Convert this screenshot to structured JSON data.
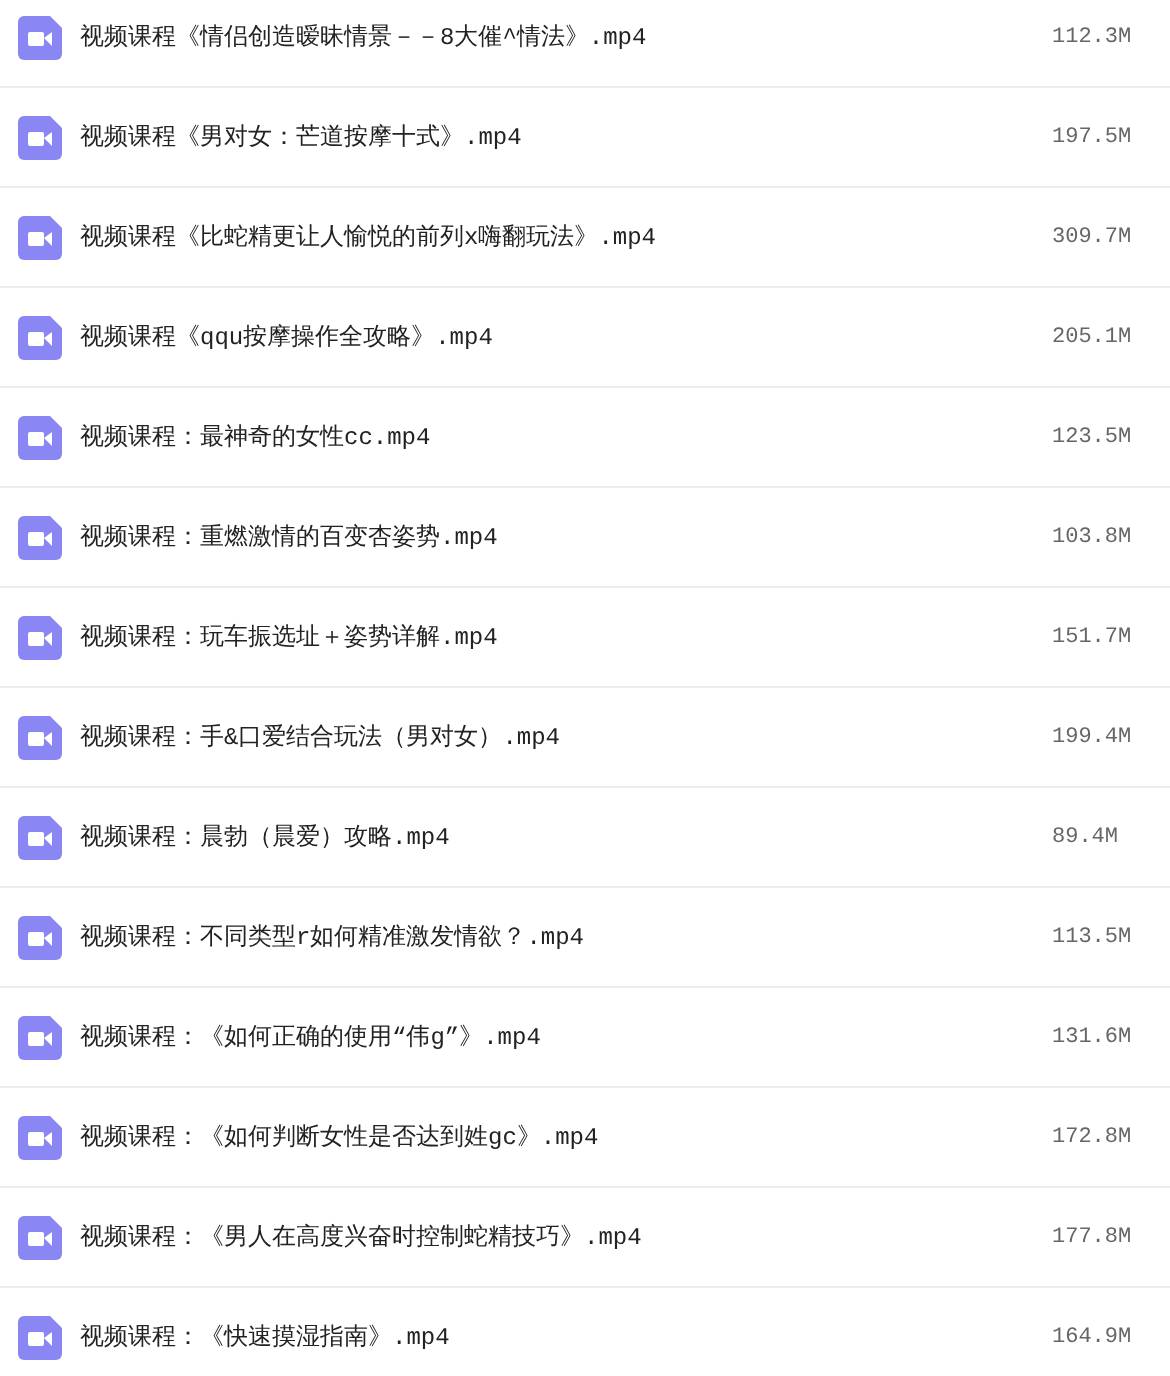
{
  "files": [
    {
      "name": "视频课程《情侣创造暧昧情景－－8大催^情法》.mp4",
      "size": "112.3M"
    },
    {
      "name": "视频课程《男对女：芒道按摩十式》.mp4",
      "size": "197.5M"
    },
    {
      "name": "视频课程《比蛇精更让人愉悦的前列x嗨翻玩法》.mp4",
      "size": "309.7M"
    },
    {
      "name": "视频课程《qqu按摩操作全攻略》.mp4",
      "size": "205.1M"
    },
    {
      "name": "视频课程：最神奇的女性cc.mp4",
      "size": "123.5M"
    },
    {
      "name": "视频课程：重燃激情的百变杏姿势.mp4",
      "size": "103.8M"
    },
    {
      "name": "视频课程：玩车振选址＋姿势详解.mp4",
      "size": "151.7M"
    },
    {
      "name": "视频课程：手&口爱结合玩法（男对女）.mp4",
      "size": "199.4M"
    },
    {
      "name": "视频课程：晨勃（晨爱）攻略.mp4",
      "size": "89.4M"
    },
    {
      "name": "视频课程：不同类型r如何精准激发情欲？.mp4",
      "size": "113.5M"
    },
    {
      "name": "视频课程：《如何正确的使用“伟g”》.mp4",
      "size": "131.6M"
    },
    {
      "name": "视频课程：《如何判断女性是否达到姓gc》.mp4",
      "size": "172.8M"
    },
    {
      "name": "视频课程：《男人在高度兴奋时控制蛇精技巧》.mp4",
      "size": "177.8M"
    },
    {
      "name": "视频课程：《快速摸湿指南》.mp4",
      "size": "164.9M"
    }
  ]
}
